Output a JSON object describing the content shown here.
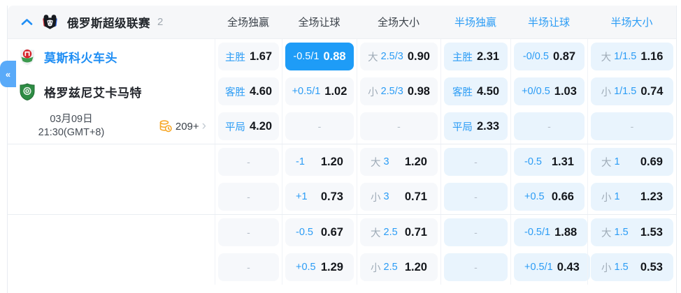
{
  "colors": {
    "highlight_blue": "#1e9cf7",
    "link_blue": "#2b9cf5",
    "ft_cell_bg": "#f6f8fb",
    "ht_cell_bg": "#e9f4fd",
    "home_team_blue": "#1d8df4",
    "side_tab_blue": "#59aaf9",
    "markets_icon_orange": "#f7a82a"
  },
  "dash": "-",
  "icons": {
    "collapse_tab": "«",
    "more_chevron": "›"
  },
  "header": {
    "league_name": "俄罗斯超级联赛",
    "match_count": "2",
    "columns": [
      {
        "id": "ft-1x2",
        "label": "全场独赢",
        "period": "full"
      },
      {
        "id": "ft-handicap",
        "label": "全场让球",
        "period": "full"
      },
      {
        "id": "ft-ou",
        "label": "全场大小",
        "period": "full"
      },
      {
        "id": "ht-1x2",
        "label": "半场独赢",
        "period": "half"
      },
      {
        "id": "ht-handicap",
        "label": "半场让球",
        "period": "half"
      },
      {
        "id": "ht-ou",
        "label": "半场大小",
        "period": "half"
      }
    ]
  },
  "match": {
    "home_team": "莫斯科火车头",
    "away_team": "格罗兹尼艾卡马特",
    "date": "03月09日",
    "time": "21:30(GMT+8)",
    "markets_count": "209+"
  },
  "odds_groups": [
    {
      "rows": [
        [
          {
            "h": "主胜",
            "o": "1.67"
          },
          {
            "h": "-0.5/1",
            "o": "0.88",
            "hl": true
          },
          {
            "p": "大",
            "h": "2.5/3",
            "o": "0.90"
          },
          {
            "h": "主胜",
            "o": "2.31"
          },
          {
            "h": "-0/0.5",
            "o": "0.87"
          },
          {
            "p": "大",
            "h": "1/1.5",
            "o": "1.16"
          }
        ],
        [
          {
            "h": "客胜",
            "o": "4.60"
          },
          {
            "h": "+0.5/1",
            "o": "1.02"
          },
          {
            "p": "小",
            "h": "2.5/3",
            "o": "0.98"
          },
          {
            "h": "客胜",
            "o": "4.50"
          },
          {
            "h": "+0/0.5",
            "o": "1.03"
          },
          {
            "p": "小",
            "h": "1/1.5",
            "o": "0.74"
          }
        ],
        [
          {
            "h": "平局",
            "o": "4.20"
          },
          {
            "dash": true
          },
          {
            "dash": true
          },
          {
            "h": "平局",
            "o": "2.33"
          },
          {
            "dash": true
          },
          {
            "dash": true
          }
        ]
      ]
    },
    {
      "rows": [
        [
          {
            "dash": true
          },
          {
            "h": "-1",
            "o": "1.20"
          },
          {
            "p": "大",
            "h": "3",
            "o": "1.20"
          },
          {
            "dash": true
          },
          {
            "h": "-0.5",
            "o": "1.31"
          },
          {
            "p": "大",
            "h": "1",
            "o": "0.69"
          }
        ],
        [
          {
            "dash": true
          },
          {
            "h": "+1",
            "o": "0.73"
          },
          {
            "p": "小",
            "h": "3",
            "o": "0.71"
          },
          {
            "dash": true
          },
          {
            "h": "+0.5",
            "o": "0.66"
          },
          {
            "p": "小",
            "h": "1",
            "o": "1.23"
          }
        ]
      ]
    },
    {
      "rows": [
        [
          {
            "dash": true
          },
          {
            "h": "-0.5",
            "o": "0.67"
          },
          {
            "p": "大",
            "h": "2.5",
            "o": "0.71"
          },
          {
            "dash": true
          },
          {
            "h": "-0.5/1",
            "o": "1.88"
          },
          {
            "p": "大",
            "h": "1.5",
            "o": "1.53"
          }
        ],
        [
          {
            "dash": true
          },
          {
            "h": "+0.5",
            "o": "1.29"
          },
          {
            "p": "小",
            "h": "2.5",
            "o": "1.20"
          },
          {
            "dash": true
          },
          {
            "h": "+0.5/1",
            "o": "0.43"
          },
          {
            "p": "小",
            "h": "1.5",
            "o": "0.53"
          }
        ]
      ]
    }
  ]
}
